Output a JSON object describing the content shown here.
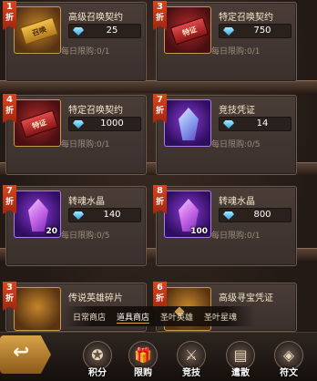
{
  "items": [
    {
      "discount": "1",
      "discount_suffix": "折",
      "title": "高级召唤契约",
      "price": "25",
      "limit": "每日限购:0/1",
      "icon": "gold-summon-ticket-icon",
      "ticket_text": "召唤",
      "qty": ""
    },
    {
      "discount": "3",
      "discount_suffix": "折",
      "title": "特定召唤契约",
      "price": "750",
      "limit": "每日限购:0/1",
      "icon": "red-summon-ticket-icon",
      "ticket_text": "特证",
      "qty": ""
    },
    {
      "discount": "4",
      "discount_suffix": "折",
      "title": "特定召唤契约",
      "price": "1000",
      "limit": "每日限购:0/1",
      "icon": "red-summon-ticket-icon",
      "ticket_text": "特证",
      "qty": ""
    },
    {
      "discount": "7",
      "discount_suffix": "折",
      "title": "竞技凭证",
      "price": "14",
      "limit": "每日限购:0/5",
      "icon": "arena-crystal-icon",
      "ticket_text": "",
      "qty": ""
    },
    {
      "discount": "7",
      "discount_suffix": "折",
      "title": "转魂水晶",
      "price": "140",
      "limit": "每日限购:0/5",
      "icon": "soul-crystal-icon",
      "ticket_text": "",
      "qty": "20"
    },
    {
      "discount": "8",
      "discount_suffix": "折",
      "title": "转魂水晶",
      "price": "800",
      "limit": "每日限购:0/1",
      "icon": "soul-crystal-icon",
      "ticket_text": "",
      "qty": "100"
    },
    {
      "discount": "3",
      "discount_suffix": "折",
      "title": "传说英雄碎片",
      "price": "",
      "limit": "",
      "icon": "hero-shard-icon",
      "ticket_text": "",
      "qty": ""
    },
    {
      "discount": "6",
      "discount_suffix": "折",
      "title": "高级寻宝凭证",
      "price": "",
      "limit": "",
      "icon": "treasure-ticket-icon",
      "ticket_text": "",
      "qty": ""
    }
  ],
  "tabs": [
    "日常商店",
    "道具商店",
    "圣叶英雄",
    "圣叶星魂"
  ],
  "active_tab": "道具商店",
  "nav": [
    {
      "label": "积分",
      "icon": "points-icon",
      "glyph": "✪"
    },
    {
      "label": "限购",
      "icon": "limited-gift-icon",
      "glyph": "🎁"
    },
    {
      "label": "竞技",
      "icon": "crossed-swords-icon",
      "glyph": "⚔"
    },
    {
      "label": "遣散",
      "icon": "dismiss-book-icon",
      "glyph": "▤"
    },
    {
      "label": "符文",
      "icon": "rune-icon",
      "glyph": "◈"
    }
  ],
  "back_label": "回",
  "colors": {
    "discount_badge": "#c4361a",
    "gem": "#3fb6f0",
    "background": "#2a201b"
  }
}
